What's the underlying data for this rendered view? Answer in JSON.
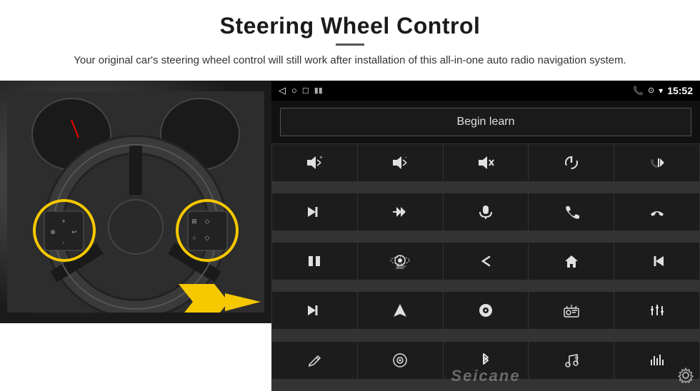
{
  "header": {
    "title": "Steering Wheel Control",
    "divider": true,
    "subtitle": "Your original car's steering wheel control will still work after installation of this all-in-one auto radio navigation system."
  },
  "android_ui": {
    "status_bar": {
      "back_icon": "◁",
      "home_icon": "○",
      "recents_icon": "□",
      "battery_icon": "▮▯",
      "phone_icon": "📞",
      "location_icon": "⊙",
      "wifi_icon": "▾",
      "time": "15:52"
    },
    "begin_learn_label": "Begin learn",
    "controls": [
      {
        "icon": "🔊+",
        "label": "vol-up"
      },
      {
        "icon": "🔊-",
        "label": "vol-down"
      },
      {
        "icon": "🔇",
        "label": "mute"
      },
      {
        "icon": "⏻",
        "label": "power"
      },
      {
        "icon": "⏭",
        "label": "prev-track"
      },
      {
        "icon": "⏭",
        "label": "next"
      },
      {
        "icon": "⏯",
        "label": "fast-forward"
      },
      {
        "icon": "🎤",
        "label": "mic"
      },
      {
        "icon": "📞",
        "label": "call"
      },
      {
        "icon": "📵",
        "label": "hang-up"
      },
      {
        "icon": "📢",
        "label": "src"
      },
      {
        "icon": "360°",
        "label": "camera"
      },
      {
        "icon": "↩",
        "label": "back"
      },
      {
        "icon": "🏠",
        "label": "home"
      },
      {
        "icon": "⏮",
        "label": "prev"
      },
      {
        "icon": "⏭",
        "label": "skip"
      },
      {
        "icon": "➤",
        "label": "nav"
      },
      {
        "icon": "⏺",
        "label": "media"
      },
      {
        "icon": "📻",
        "label": "radio"
      },
      {
        "icon": "⚙",
        "label": "eq"
      },
      {
        "icon": "✏",
        "label": "write"
      },
      {
        "icon": "⊙",
        "label": "settings"
      },
      {
        "icon": "✱",
        "label": "bt"
      },
      {
        "icon": "♫",
        "label": "music"
      },
      {
        "icon": "|||",
        "label": "spectrum"
      }
    ],
    "watermark": "Seicane"
  }
}
